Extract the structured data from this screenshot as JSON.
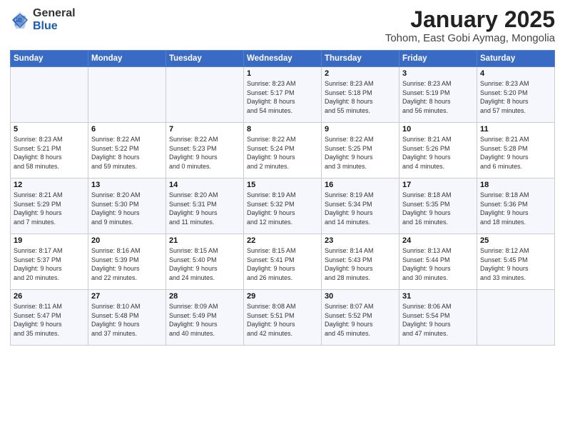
{
  "logo": {
    "general": "General",
    "blue": "Blue"
  },
  "title": "January 2025",
  "subtitle": "Tohom, East Gobi Aymag, Mongolia",
  "weekdays": [
    "Sunday",
    "Monday",
    "Tuesday",
    "Wednesday",
    "Thursday",
    "Friday",
    "Saturday"
  ],
  "weeks": [
    [
      {
        "day": "",
        "info": ""
      },
      {
        "day": "",
        "info": ""
      },
      {
        "day": "",
        "info": ""
      },
      {
        "day": "1",
        "info": "Sunrise: 8:23 AM\nSunset: 5:17 PM\nDaylight: 8 hours\nand 54 minutes."
      },
      {
        "day": "2",
        "info": "Sunrise: 8:23 AM\nSunset: 5:18 PM\nDaylight: 8 hours\nand 55 minutes."
      },
      {
        "day": "3",
        "info": "Sunrise: 8:23 AM\nSunset: 5:19 PM\nDaylight: 8 hours\nand 56 minutes."
      },
      {
        "day": "4",
        "info": "Sunrise: 8:23 AM\nSunset: 5:20 PM\nDaylight: 8 hours\nand 57 minutes."
      }
    ],
    [
      {
        "day": "5",
        "info": "Sunrise: 8:23 AM\nSunset: 5:21 PM\nDaylight: 8 hours\nand 58 minutes."
      },
      {
        "day": "6",
        "info": "Sunrise: 8:22 AM\nSunset: 5:22 PM\nDaylight: 8 hours\nand 59 minutes."
      },
      {
        "day": "7",
        "info": "Sunrise: 8:22 AM\nSunset: 5:23 PM\nDaylight: 9 hours\nand 0 minutes."
      },
      {
        "day": "8",
        "info": "Sunrise: 8:22 AM\nSunset: 5:24 PM\nDaylight: 9 hours\nand 2 minutes."
      },
      {
        "day": "9",
        "info": "Sunrise: 8:22 AM\nSunset: 5:25 PM\nDaylight: 9 hours\nand 3 minutes."
      },
      {
        "day": "10",
        "info": "Sunrise: 8:21 AM\nSunset: 5:26 PM\nDaylight: 9 hours\nand 4 minutes."
      },
      {
        "day": "11",
        "info": "Sunrise: 8:21 AM\nSunset: 5:28 PM\nDaylight: 9 hours\nand 6 minutes."
      }
    ],
    [
      {
        "day": "12",
        "info": "Sunrise: 8:21 AM\nSunset: 5:29 PM\nDaylight: 9 hours\nand 7 minutes."
      },
      {
        "day": "13",
        "info": "Sunrise: 8:20 AM\nSunset: 5:30 PM\nDaylight: 9 hours\nand 9 minutes."
      },
      {
        "day": "14",
        "info": "Sunrise: 8:20 AM\nSunset: 5:31 PM\nDaylight: 9 hours\nand 11 minutes."
      },
      {
        "day": "15",
        "info": "Sunrise: 8:19 AM\nSunset: 5:32 PM\nDaylight: 9 hours\nand 12 minutes."
      },
      {
        "day": "16",
        "info": "Sunrise: 8:19 AM\nSunset: 5:34 PM\nDaylight: 9 hours\nand 14 minutes."
      },
      {
        "day": "17",
        "info": "Sunrise: 8:18 AM\nSunset: 5:35 PM\nDaylight: 9 hours\nand 16 minutes."
      },
      {
        "day": "18",
        "info": "Sunrise: 8:18 AM\nSunset: 5:36 PM\nDaylight: 9 hours\nand 18 minutes."
      }
    ],
    [
      {
        "day": "19",
        "info": "Sunrise: 8:17 AM\nSunset: 5:37 PM\nDaylight: 9 hours\nand 20 minutes."
      },
      {
        "day": "20",
        "info": "Sunrise: 8:16 AM\nSunset: 5:39 PM\nDaylight: 9 hours\nand 22 minutes."
      },
      {
        "day": "21",
        "info": "Sunrise: 8:15 AM\nSunset: 5:40 PM\nDaylight: 9 hours\nand 24 minutes."
      },
      {
        "day": "22",
        "info": "Sunrise: 8:15 AM\nSunset: 5:41 PM\nDaylight: 9 hours\nand 26 minutes."
      },
      {
        "day": "23",
        "info": "Sunrise: 8:14 AM\nSunset: 5:43 PM\nDaylight: 9 hours\nand 28 minutes."
      },
      {
        "day": "24",
        "info": "Sunrise: 8:13 AM\nSunset: 5:44 PM\nDaylight: 9 hours\nand 30 minutes."
      },
      {
        "day": "25",
        "info": "Sunrise: 8:12 AM\nSunset: 5:45 PM\nDaylight: 9 hours\nand 33 minutes."
      }
    ],
    [
      {
        "day": "26",
        "info": "Sunrise: 8:11 AM\nSunset: 5:47 PM\nDaylight: 9 hours\nand 35 minutes."
      },
      {
        "day": "27",
        "info": "Sunrise: 8:10 AM\nSunset: 5:48 PM\nDaylight: 9 hours\nand 37 minutes."
      },
      {
        "day": "28",
        "info": "Sunrise: 8:09 AM\nSunset: 5:49 PM\nDaylight: 9 hours\nand 40 minutes."
      },
      {
        "day": "29",
        "info": "Sunrise: 8:08 AM\nSunset: 5:51 PM\nDaylight: 9 hours\nand 42 minutes."
      },
      {
        "day": "30",
        "info": "Sunrise: 8:07 AM\nSunset: 5:52 PM\nDaylight: 9 hours\nand 45 minutes."
      },
      {
        "day": "31",
        "info": "Sunrise: 8:06 AM\nSunset: 5:54 PM\nDaylight: 9 hours\nand 47 minutes."
      },
      {
        "day": "",
        "info": ""
      }
    ]
  ]
}
